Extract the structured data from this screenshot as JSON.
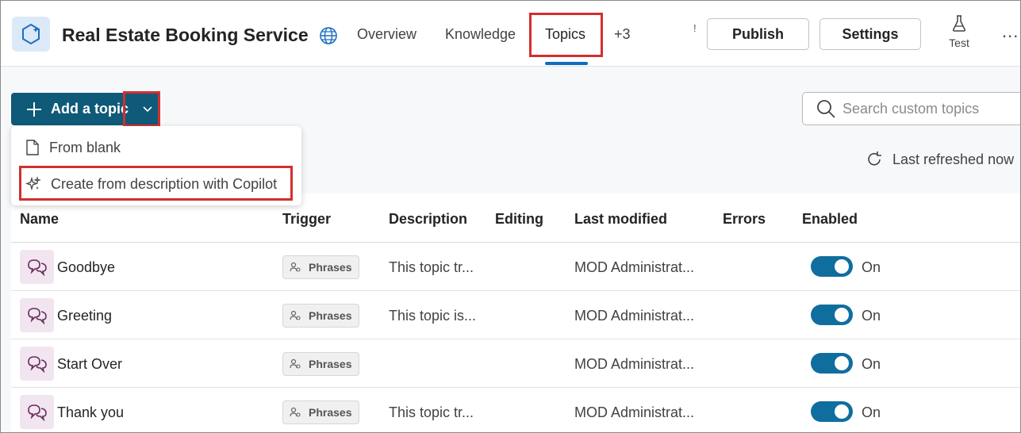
{
  "header": {
    "app_title": "Real Estate Booking Service",
    "nav": [
      {
        "label": "Overview"
      },
      {
        "label": "Knowledge"
      },
      {
        "label": "Topics"
      },
      {
        "label": "+3"
      }
    ],
    "active_tab": "Topics",
    "small_mark": "!",
    "publish_label": "Publish",
    "settings_label": "Settings",
    "test_label": "Test",
    "more_label": "..."
  },
  "toolbar": {
    "add_topic_label": "Add a topic",
    "search_placeholder": "Search custom topics",
    "refresh_label": "Last refreshed now"
  },
  "add_menu": {
    "items": [
      {
        "label": "From blank",
        "icon": "document-icon"
      },
      {
        "label": "Create from description with Copilot",
        "icon": "sparkle-icon"
      }
    ]
  },
  "table": {
    "columns": [
      "Name",
      "Trigger",
      "Description",
      "Editing",
      "Last modified",
      "Errors",
      "Enabled"
    ],
    "rows": [
      {
        "name": "Goodbye",
        "trigger": "Phrases",
        "description": "This topic tr...",
        "modified": "MOD Administrat...",
        "enabled_label": "On"
      },
      {
        "name": "Greeting",
        "trigger": "Phrases",
        "description": "This topic is...",
        "modified": "MOD Administrat...",
        "enabled_label": "On"
      },
      {
        "name": "Start Over",
        "trigger": "Phrases",
        "description": "",
        "modified": "MOD Administrat...",
        "enabled_label": "On"
      },
      {
        "name": "Thank you",
        "trigger": "Phrases",
        "description": "This topic tr...",
        "modified": "MOD Administrat...",
        "enabled_label": "On"
      }
    ]
  },
  "colors": {
    "primary": "#0f5a78",
    "toggle_on": "#0f6e9e",
    "accent_underline": "#0f6cbd",
    "highlight": "#d32f2f",
    "topic_icon_bg": "#f1e6ef"
  }
}
